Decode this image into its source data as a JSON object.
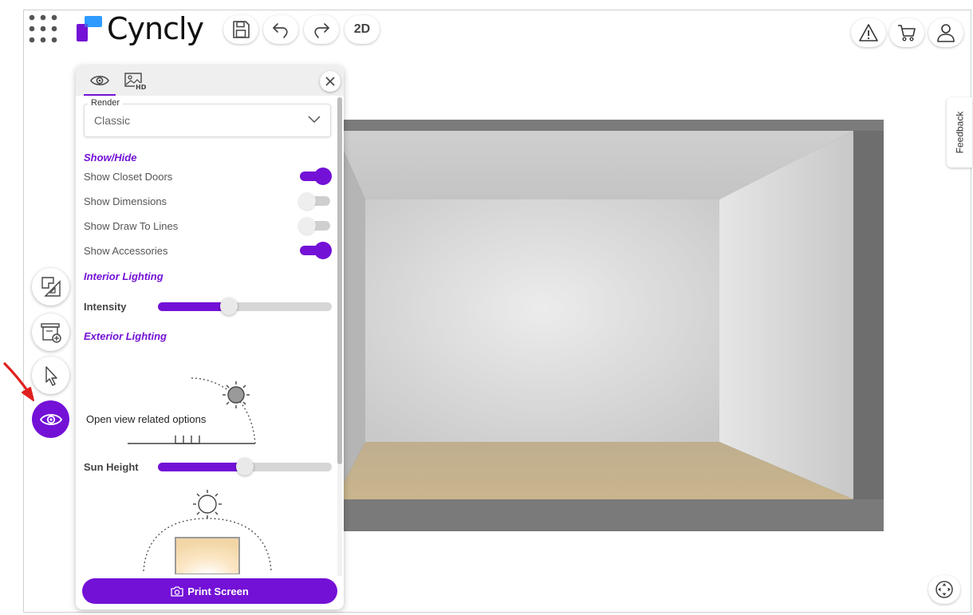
{
  "app": {
    "brand": "Cyncly",
    "icons": {
      "apps": "grid-dots-icon",
      "save": "save-icon",
      "undo": "undo-icon",
      "redo": "redo-icon",
      "warning": "warning-icon",
      "cart": "cart-icon",
      "user": "user-icon",
      "navigate": "navigation-icon"
    }
  },
  "toolbar": {
    "view_mode_label": "2D"
  },
  "feedback": {
    "label": "Feedback"
  },
  "sidebar": {
    "items": [
      {
        "name": "floor-plan-tool",
        "icon": "floorplan-ruler-icon"
      },
      {
        "name": "add-cabinet-tool",
        "icon": "cabinet-add-icon"
      },
      {
        "name": "select-tool",
        "icon": "cursor-icon"
      },
      {
        "name": "view-options-tool",
        "icon": "eye-icon",
        "active": true
      }
    ]
  },
  "view_panel": {
    "tabs": [
      {
        "name": "view",
        "icon": "eye-icon",
        "active": true
      },
      {
        "name": "hd-render",
        "icon": "hd-image-icon",
        "active": false
      }
    ],
    "render": {
      "label": "Render",
      "value": "Classic"
    },
    "show_hide": {
      "title": "Show/Hide",
      "items": [
        {
          "label": "Show Closet Doors",
          "on": true
        },
        {
          "label": "Show Dimensions",
          "on": false
        },
        {
          "label": "Show Draw To Lines",
          "on": false
        },
        {
          "label": "Show Accessories",
          "on": true
        }
      ]
    },
    "interior_lighting": {
      "title": "Interior Lighting",
      "intensity_label": "Intensity",
      "intensity_value": 0.41
    },
    "exterior_lighting": {
      "title": "Exterior Lighting",
      "sun_height_label": "Sun Height",
      "sun_height_value": 0.5
    },
    "tooltip": "Open view related options",
    "print_button": "Print Screen"
  },
  "colors": {
    "accent": "#7311d6",
    "annotation_arrow": "#e02020"
  }
}
